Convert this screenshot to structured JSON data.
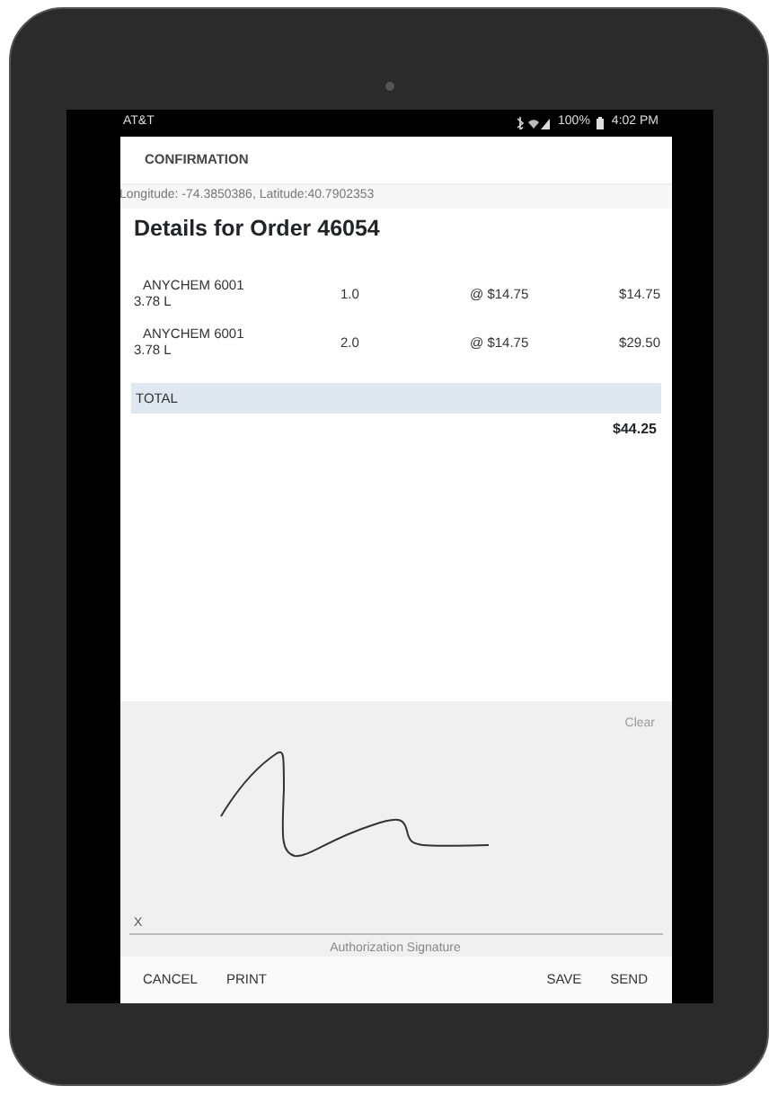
{
  "status_bar": {
    "carrier": "AT&T",
    "battery": "100%",
    "time": "4:02 PM"
  },
  "toolbar": {
    "title": "CONFIRMATION"
  },
  "location": "Longitude: -74.3850386, Latitude:40.7902353",
  "heading": "Details for Order 46054",
  "items": [
    {
      "name": "ANYCHEM 6001",
      "size": "3.78 L",
      "quantity": "1.0",
      "price": "@ $14.75",
      "amount": "$14.75"
    },
    {
      "name": "ANYCHEM 6001",
      "size": "3.78 L",
      "quantity": "2.0",
      "price": "@ $14.75",
      "amount": "$29.50"
    }
  ],
  "total": {
    "label": "TOTAL",
    "amount": "$44.25"
  },
  "signature": {
    "clear": "Clear",
    "mark": "X",
    "caption": "Authorization Signature"
  },
  "buttons_left": [
    "CANCEL",
    "PRINT"
  ],
  "buttons_right": [
    "SAVE",
    "SEND"
  ]
}
